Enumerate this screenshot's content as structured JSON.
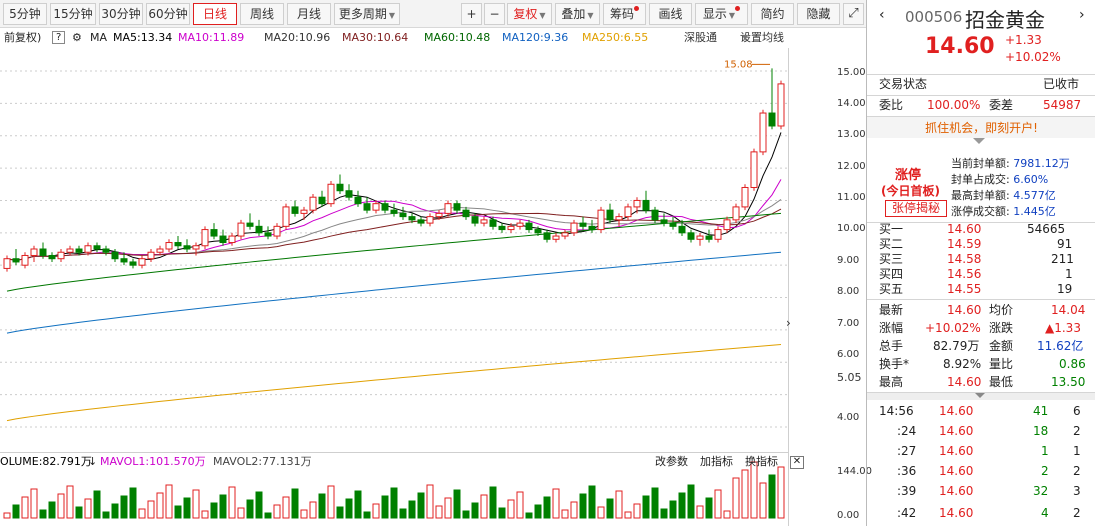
{
  "toolbar": {
    "periods": [
      "5分钟",
      "15分钟",
      "30分钟",
      "60分钟",
      "日线",
      "周线",
      "月线",
      "更多周期"
    ],
    "buttons": [
      "+",
      "−",
      "复权",
      "叠加",
      "筹码",
      "画线",
      "显示",
      "简约",
      "隐藏"
    ],
    "icon_expand": "expand-icon"
  },
  "indicators": {
    "fq": "前复权)",
    "q": "?",
    "ma": "MA",
    "ma5": "MA5:13.34",
    "ma10": "MA10:11.89",
    "ma20": "MA20:10.96",
    "ma30": "MA30:10.64",
    "ma60": "MA60:10.48",
    "ma120": "MA120:9.36",
    "ma250": "MA250:6.55",
    "sg": "深股通",
    "set": "设置均线"
  },
  "price_axis": [
    "15.00",
    "14.00",
    "13.00",
    "12.00",
    "11.00",
    "10.00",
    "9.00",
    "8.00",
    "7.00",
    "6.00",
    "5.05",
    "4.00"
  ],
  "max_label": "15.08",
  "volume": {
    "vol": "OLUME:82.791万",
    "mavol1": "MAVOL1:101.570万",
    "mavol2": "MAVOL2:77.131万",
    "buttons": [
      "改参数",
      "加指标",
      "换指标"
    ],
    "axis": [
      "144.00",
      "0.00"
    ]
  },
  "chart_data": {
    "type": "candlestick",
    "ylim": [
      3.6,
      15.4
    ],
    "candles": [
      [
        8.9,
        9.3,
        8.8,
        9.2
      ],
      [
        9.2,
        9.5,
        9.0,
        9.1
      ],
      [
        9.0,
        9.4,
        8.9,
        9.3
      ],
      [
        9.3,
        9.6,
        9.1,
        9.5
      ],
      [
        9.5,
        9.7,
        9.2,
        9.3
      ],
      [
        9.3,
        9.4,
        9.1,
        9.2
      ],
      [
        9.2,
        9.5,
        9.1,
        9.4
      ],
      [
        9.4,
        9.6,
        9.3,
        9.5
      ],
      [
        9.5,
        9.6,
        9.3,
        9.4
      ],
      [
        9.4,
        9.7,
        9.3,
        9.6
      ],
      [
        9.6,
        9.7,
        9.4,
        9.5
      ],
      [
        9.5,
        9.6,
        9.3,
        9.4
      ],
      [
        9.4,
        9.5,
        9.1,
        9.2
      ],
      [
        9.2,
        9.4,
        9.0,
        9.1
      ],
      [
        9.1,
        9.2,
        8.9,
        9.0
      ],
      [
        9.0,
        9.3,
        8.9,
        9.2
      ],
      [
        9.2,
        9.5,
        9.1,
        9.4
      ],
      [
        9.4,
        9.6,
        9.3,
        9.5
      ],
      [
        9.5,
        9.8,
        9.4,
        9.7
      ],
      [
        9.7,
        9.9,
        9.5,
        9.6
      ],
      [
        9.6,
        9.8,
        9.4,
        9.5
      ],
      [
        9.5,
        9.7,
        9.3,
        9.6
      ],
      [
        9.6,
        10.2,
        9.5,
        10.1
      ],
      [
        10.1,
        10.3,
        9.8,
        9.9
      ],
      [
        9.9,
        10.1,
        9.6,
        9.7
      ],
      [
        9.7,
        10.0,
        9.6,
        9.9
      ],
      [
        9.9,
        10.4,
        9.8,
        10.3
      ],
      [
        10.3,
        10.6,
        10.1,
        10.2
      ],
      [
        10.2,
        10.4,
        9.9,
        10.0
      ],
      [
        10.0,
        10.2,
        9.8,
        9.9
      ],
      [
        9.9,
        10.3,
        9.8,
        10.2
      ],
      [
        10.2,
        10.9,
        10.1,
        10.8
      ],
      [
        10.8,
        11.0,
        10.5,
        10.6
      ],
      [
        10.6,
        10.8,
        10.4,
        10.7
      ],
      [
        10.7,
        11.2,
        10.6,
        11.1
      ],
      [
        11.1,
        11.3,
        10.8,
        10.9
      ],
      [
        10.9,
        11.6,
        10.8,
        11.5
      ],
      [
        11.5,
        11.8,
        11.2,
        11.3
      ],
      [
        11.3,
        11.5,
        11.0,
        11.1
      ],
      [
        11.1,
        11.3,
        10.8,
        10.9
      ],
      [
        10.9,
        11.1,
        10.6,
        10.7
      ],
      [
        10.7,
        11.0,
        10.6,
        10.9
      ],
      [
        10.9,
        11.0,
        10.6,
        10.7
      ],
      [
        10.7,
        10.9,
        10.5,
        10.6
      ],
      [
        10.6,
        10.8,
        10.4,
        10.5
      ],
      [
        10.5,
        10.6,
        10.3,
        10.4
      ],
      [
        10.4,
        10.5,
        10.2,
        10.3
      ],
      [
        10.3,
        10.6,
        10.2,
        10.5
      ],
      [
        10.5,
        10.7,
        10.4,
        10.6
      ],
      [
        10.6,
        11.0,
        10.5,
        10.9
      ],
      [
        10.9,
        11.0,
        10.6,
        10.7
      ],
      [
        10.7,
        10.8,
        10.4,
        10.5
      ],
      [
        10.5,
        10.6,
        10.2,
        10.3
      ],
      [
        10.3,
        10.5,
        10.2,
        10.4
      ],
      [
        10.4,
        10.5,
        10.1,
        10.2
      ],
      [
        10.2,
        10.3,
        10.0,
        10.1
      ],
      [
        10.1,
        10.3,
        10.0,
        10.2
      ],
      [
        10.2,
        10.4,
        10.1,
        10.3
      ],
      [
        10.3,
        10.4,
        10.0,
        10.1
      ],
      [
        10.1,
        10.2,
        9.9,
        10.0
      ],
      [
        10.0,
        10.1,
        9.7,
        9.8
      ],
      [
        9.8,
        10.0,
        9.7,
        9.9
      ],
      [
        9.9,
        10.1,
        9.8,
        10.0
      ],
      [
        10.0,
        10.4,
        9.9,
        10.3
      ],
      [
        10.3,
        10.5,
        10.1,
        10.2
      ],
      [
        10.2,
        10.4,
        10.0,
        10.1
      ],
      [
        10.1,
        10.8,
        10.0,
        10.7
      ],
      [
        10.7,
        10.9,
        10.3,
        10.4
      ],
      [
        10.4,
        10.6,
        10.2,
        10.5
      ],
      [
        10.5,
        10.9,
        10.4,
        10.8
      ],
      [
        10.8,
        11.1,
        10.6,
        11.0
      ],
      [
        11.0,
        11.3,
        10.6,
        10.7
      ],
      [
        10.7,
        10.8,
        10.3,
        10.4
      ],
      [
        10.4,
        10.6,
        10.2,
        10.3
      ],
      [
        10.3,
        10.5,
        10.1,
        10.2
      ],
      [
        10.2,
        10.4,
        9.9,
        10.0
      ],
      [
        10.0,
        10.1,
        9.7,
        9.8
      ],
      [
        9.8,
        10.0,
        9.6,
        9.9
      ],
      [
        9.9,
        10.1,
        9.7,
        9.8
      ],
      [
        9.8,
        10.2,
        9.7,
        10.1
      ],
      [
        10.1,
        10.5,
        10.0,
        10.4
      ],
      [
        10.4,
        10.9,
        10.3,
        10.8
      ],
      [
        10.8,
        11.5,
        10.7,
        11.4
      ],
      [
        11.4,
        12.6,
        11.3,
        12.5
      ],
      [
        12.5,
        13.8,
        12.4,
        13.7
      ],
      [
        13.7,
        15.08,
        13.2,
        13.3
      ],
      [
        13.3,
        14.7,
        13.2,
        14.6
      ]
    ]
  },
  "right": {
    "code": "000506",
    "name": "招金黄金",
    "price": "14.60",
    "chg": "+1.33",
    "pct": "+10.02%",
    "status_label": "交易状态",
    "status": "已收市",
    "wb_label": "委比",
    "wb": "100.00%",
    "wc_label": "委差",
    "wc": "54987",
    "promo": "抓住机会，即刻开户!",
    "zt": "涨停",
    "zt_sub": "(今日首板)",
    "zt_btn": "张停揭秘",
    "seal": [
      [
        "当前封单额:",
        "7981.12万"
      ],
      [
        "封单占成交:",
        "6.60%"
      ],
      [
        "最高封单额:",
        "4.577亿"
      ],
      [
        "涨停成交额:",
        "1.445亿"
      ]
    ],
    "bids": [
      [
        "买一",
        "14.60",
        "54665"
      ],
      [
        "买二",
        "14.59",
        "91"
      ],
      [
        "买三",
        "14.58",
        "211"
      ],
      [
        "买四",
        "14.56",
        "1"
      ],
      [
        "买五",
        "14.55",
        "19"
      ]
    ],
    "stats": [
      [
        "最新",
        "14.60",
        "均价",
        "14.04"
      ],
      [
        "涨幅",
        "+10.02%",
        "涨跌",
        "▲1.33"
      ],
      [
        "总手",
        "82.79万",
        "金额",
        "11.62亿"
      ],
      [
        "换手*",
        "8.92%",
        "量比",
        "0.86"
      ],
      [
        "最高",
        "14.60",
        "最低",
        "13.50"
      ]
    ],
    "ticks": [
      [
        "14:56",
        "14.60",
        "41",
        "6"
      ],
      [
        ":24",
        "14.60",
        "18",
        "2"
      ],
      [
        ":27",
        "14.60",
        "1",
        "1"
      ],
      [
        ":36",
        "14.60",
        "2",
        "2"
      ],
      [
        ":39",
        "14.60",
        "32",
        "3"
      ],
      [
        ":42",
        "14.60",
        "4",
        "2"
      ]
    ]
  }
}
